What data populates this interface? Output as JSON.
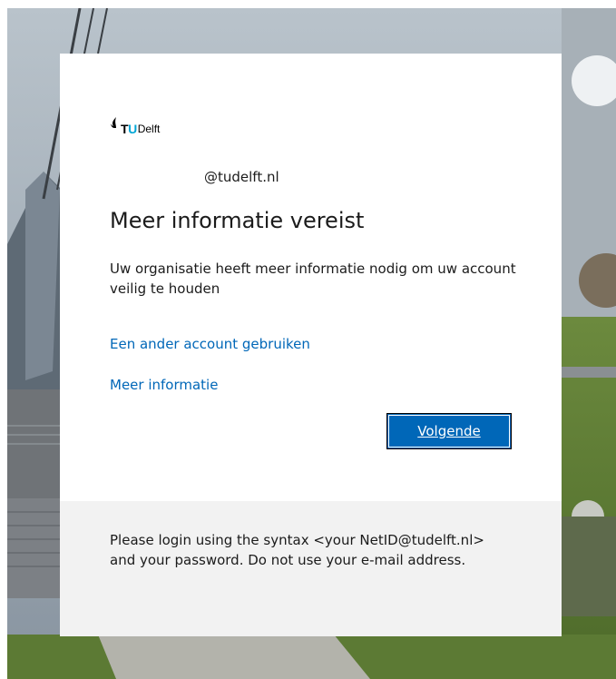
{
  "card": {
    "logo": {
      "tu_t": "T",
      "tu_u": "U",
      "delft": "Delft"
    },
    "identity": "@tudelft.nl",
    "title": "Meer informatie vereist",
    "description": "Uw organisatie heeft meer informatie nodig om uw account veilig te houden",
    "links": {
      "other_account": "Een ander account gebruiken",
      "more_info": "Meer informatie"
    },
    "next_button": "Volgende",
    "footer_text": "Please login using the syntax <your NetID@tudelft.nl> and your password. Do not use your e-mail address."
  },
  "colors": {
    "accent": "#0067b8",
    "footer_bg": "#f2f2f2",
    "logo_u": "#00a6d6"
  },
  "icons": {
    "logo": "tu-delft-flame-icon"
  }
}
